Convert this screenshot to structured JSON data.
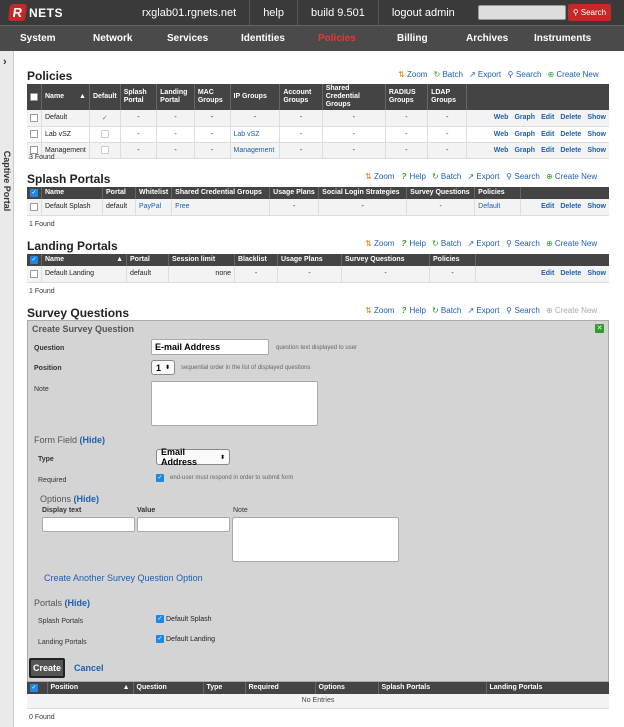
{
  "brand": {
    "logo_letter": "R",
    "logo_text": "NETS"
  },
  "topnav": {
    "host": "rxglab01.rgnets.net",
    "help": "help",
    "build": "build 9.501",
    "logout": "logout admin"
  },
  "search": {
    "placeholder": "",
    "button": "Search"
  },
  "mainnav": [
    "System",
    "Network",
    "Services",
    "Identities",
    "Policies",
    "Billing",
    "Archives",
    "Instruments"
  ],
  "active_nav": "Policies",
  "sidetab": {
    "label": "Captive Portal"
  },
  "actions": {
    "zoom": "Zoom",
    "help": "Help",
    "batch": "Batch",
    "export": "Export",
    "search": "Search",
    "create_new": "Create New"
  },
  "policies": {
    "title": "Policies",
    "headers": [
      "Name",
      "Default",
      "Splash Portal",
      "Landing Portal",
      "MAC Groups",
      "IP Groups",
      "Account Groups",
      "Shared Credential Groups",
      "RADIUS Groups",
      "LDAP Groups"
    ],
    "rows": [
      {
        "name": "Default",
        "default": "✓",
        "splash": "-",
        "landing": "-",
        "mac": "-",
        "ip": "-",
        "acct": "-",
        "shared": "-",
        "radius": "-",
        "ldap": "-"
      },
      {
        "name": "Lab vSZ",
        "default": "",
        "splash": "-",
        "landing": "-",
        "mac": "-",
        "ip": "Lab vSZ",
        "acct": "-",
        "shared": "-",
        "radius": "-",
        "ldap": "-"
      },
      {
        "name": "Management",
        "default": "",
        "splash": "-",
        "landing": "-",
        "mac": "-",
        "ip": "Management",
        "acct": "-",
        "shared": "-",
        "radius": "-",
        "ldap": "-"
      }
    ],
    "row_actions": [
      "Web",
      "Graph",
      "Edit",
      "Delete",
      "Show"
    ],
    "found": "3 Found"
  },
  "splash": {
    "title": "Splash Portals",
    "headers": [
      "Name",
      "Portal",
      "Whitelist",
      "Shared Credential Groups",
      "Usage Plans",
      "Social Login Strategies",
      "Survey Questions",
      "Policies"
    ],
    "row": {
      "name": "Default Splash",
      "portal": "default",
      "whitelist": "PayPal",
      "shared": "Free",
      "usage": "-",
      "social": "-",
      "survey": "-",
      "policies": "Default"
    },
    "row_actions": [
      "Edit",
      "Delete",
      "Show"
    ],
    "found": "1 Found"
  },
  "landing": {
    "title": "Landing Portals",
    "headers": [
      "Name",
      "Portal",
      "Session limit",
      "Blacklist",
      "Usage Plans",
      "Survey Questions",
      "Policies"
    ],
    "row": {
      "name": "Default Landing",
      "portal": "default",
      "session": "none",
      "blacklist": "-",
      "usage": "-",
      "survey": "-",
      "policies": "-"
    },
    "row_actions": [
      "Edit",
      "Delete",
      "Show"
    ],
    "found": "1 Found"
  },
  "survey": {
    "title": "Survey Questions",
    "form_title": "Create Survey Question",
    "question_label": "Question",
    "question_value": "E-mail Address",
    "question_hint": "question text displayed to user",
    "position_label": "Position",
    "position_value": "1",
    "position_hint": "sequential order in the list of displayed questions",
    "note_label": "Note",
    "form_field_title": "Form Field",
    "hide": "(Hide)",
    "type_label": "Type",
    "type_value": "Email Address",
    "required_label": "Required",
    "required_hint": "end-user must respond in order to submit form",
    "options_title": "Options",
    "display_text_label": "Display text",
    "value_label": "Value",
    "options_note_label": "Note",
    "create_another": "Create Another Survey Question Option",
    "portals_title": "Portals",
    "splash_portals_label": "Splash Portals",
    "splash_portals_value": "Default Splash",
    "landing_portals_label": "Landing Portals",
    "landing_portals_value": "Default Landing",
    "create": "Create",
    "cancel": "Cancel",
    "headers": [
      "Position",
      "Question",
      "Type",
      "Required",
      "Options",
      "Splash Portals",
      "Landing Portals"
    ],
    "no_entries": "No Entries",
    "found": "0 Found"
  }
}
